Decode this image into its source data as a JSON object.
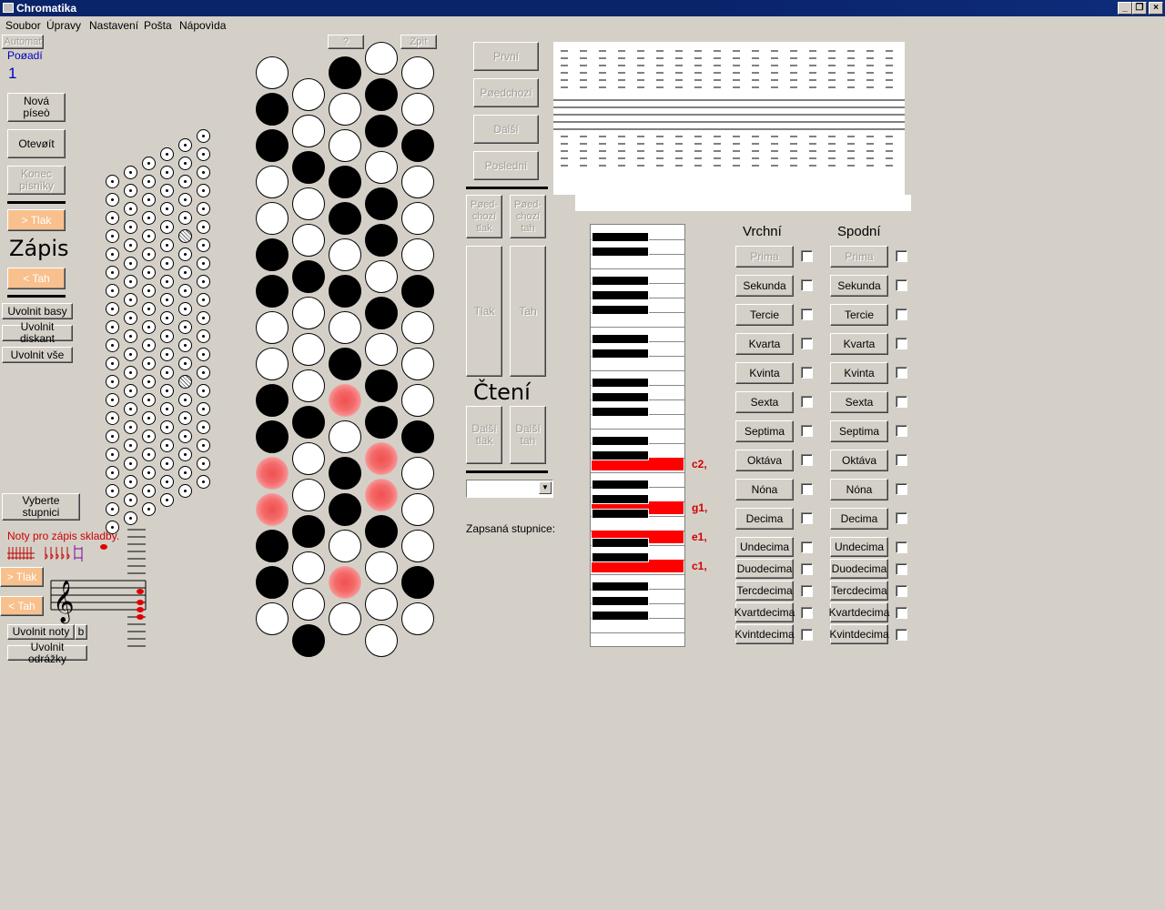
{
  "window": {
    "title": "Chromatika"
  },
  "menu": [
    "Soubor",
    "Úpravy",
    "Nastavení",
    "Pošta",
    "Nápovìda"
  ],
  "left": {
    "automat": "Automat",
    "poradi_label": "Poøadí",
    "poradi_value": "1",
    "new_song": "Nová píseò",
    "open": "Otevøít",
    "end_song": "Konec písnìky",
    "push": "> Tlak",
    "write_title": "Zápis",
    "pull": "< Tah",
    "release_bass": "Uvolnit basy",
    "release_treble": "Uvolnit diskant",
    "release_all": "Uvolnit vše",
    "choose_scale": "Vyberte stupnici",
    "notes_hint": "Noty pro zápis skladby.",
    "push2": "> Tlak",
    "pull2": "< Tah",
    "release_notes": "Uvolnit noty",
    "flat": "b",
    "release_ledger": "Uvolnit odrážky"
  },
  "top_small": {
    "help": "?",
    "back": "Zpìt"
  },
  "nav": {
    "first": "První",
    "prev": "Pøedchozí",
    "next": "Další",
    "last": "Poslední",
    "prev_push": "Pøed-chozí tlak",
    "prev_pull": "Pøed-chozí tah",
    "push": "Tlak",
    "pull": "Tah",
    "read_title": "Čtení",
    "next_push": "Další tlak",
    "next_pull": "Další tah",
    "scale_label": "Zapsaná stupnice:"
  },
  "piano_labels": [
    "c2,",
    "g1,",
    "e1,",
    "c1,"
  ],
  "intervals": {
    "upper_title": "Vrchní",
    "lower_title": "Spodní",
    "items": [
      "Prima",
      "Sekunda",
      "Tercie",
      "Kvarta",
      "Kvinta",
      "Sexta",
      "Septima",
      "Oktáva",
      "Nóna",
      "Decima",
      "Undecima",
      "Duodecima",
      "Tercdecima",
      "Kvartdecima",
      "Kvintdecima"
    ]
  }
}
